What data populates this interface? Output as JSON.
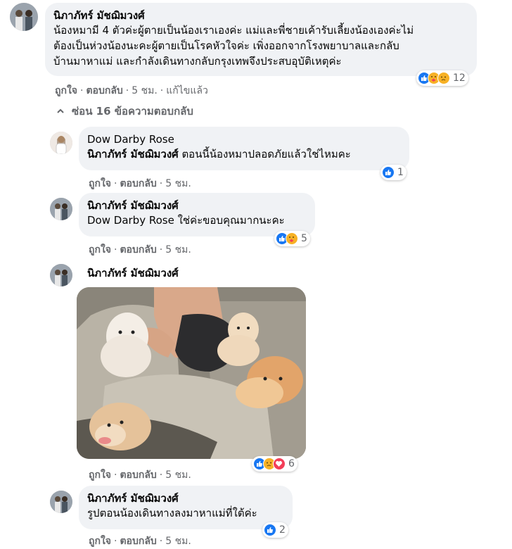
{
  "comments": [
    {
      "author": "นิภาภัทร์ มัชฌิมวงศ์",
      "lines": [
        "น้องหมามี 4 ตัวค่ะผู้ตายเป็นน้องเราเองค่ะ แม่และพี่ชายเค้ารับเลี้ยงน้องเองค่ะไม่",
        "ต้องเป็นห่วงน้องนะคะผู้ตายเป็นโรคหัวใจค่ะ เพิ่งออกจากโรงพยาบาลและกลับ",
        "บ้านมาหาแม่ และกำลังเดินทางกลับกรุงเทพจึงประสบอุบัติเหตุค่ะ"
      ],
      "actions": {
        "like": "ถูกใจ",
        "reply": "ตอบกลับ",
        "time": "5 ชม.",
        "edited": "แก้ไขแล้ว"
      },
      "reactions": {
        "icons": [
          "like-icon",
          "care-icon",
          "sad-icon"
        ],
        "count": "12"
      }
    }
  ],
  "hide_replies": {
    "label": "ซ่อน 16 ข้อความตอบกลับ",
    "icon": "chevron-up-icon"
  },
  "replies": [
    {
      "author": "Dow Darby Rose",
      "mention": "นิภาภัทร์ มัชฌิมวงศ์",
      "text": " ตอนนี้น้องหมาปลอดภัยแล้วใช่ไหมคะ",
      "actions": {
        "like": "ถูกใจ",
        "reply": "ตอบกลับ",
        "time": "5 ชม."
      },
      "reactions": {
        "icons": [
          "like-icon"
        ],
        "count": "1"
      }
    },
    {
      "author": "นิภาภัทร์ มัชฌิมวงศ์",
      "mention": "Dow Darby Rose",
      "text": " ใช่ค่ะขอบคุณมากนะคะ",
      "actions": {
        "like": "ถูกใจ",
        "reply": "ตอบกลับ",
        "time": "5 ชม."
      },
      "reactions": {
        "icons": [
          "like-icon",
          "care-icon"
        ],
        "count": "5"
      }
    },
    {
      "author": "นิภาภัทร์ มัชฌิมวงศ์",
      "photo": "pomeranian-dogs-in-car-photo",
      "actions": {
        "like": "ถูกใจ",
        "reply": "ตอบกลับ",
        "time": "5 ชม."
      },
      "reactions": {
        "icons": [
          "like-icon",
          "sad-icon",
          "love-icon"
        ],
        "count": "6"
      }
    },
    {
      "author": "นิภาภัทร์ มัชฌิมวงศ์",
      "text": "รูปตอนน้องเดินทางลงมาหาแม่ที่ใต้ค่ะ",
      "actions": {
        "like": "ถูกใจ",
        "reply": "ตอบกลับ",
        "time": "5 ชม."
      },
      "reactions": {
        "icons": [
          "like-icon"
        ],
        "count": "2"
      }
    }
  ],
  "colors": {
    "bubble": "#f0f2f5",
    "secondary_text": "#65676b",
    "like_blue": "#1877f2",
    "love_red": "#f33e58",
    "emoji_yellow": "#f7b125"
  }
}
